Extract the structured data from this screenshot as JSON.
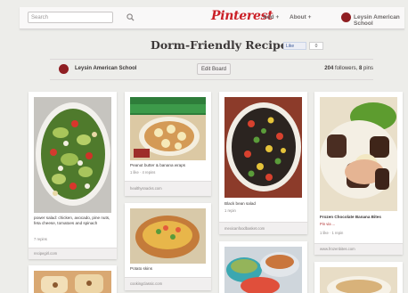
{
  "header": {
    "search_placeholder": "Search",
    "logo": "Pinterest",
    "add": "Add +",
    "about": "About +",
    "user": "Leysin American School"
  },
  "board": {
    "title": "Dorm-Friendly Recipes",
    "fb_like": "Like",
    "owner": "Leysin American School",
    "edit_label": "Edit Board",
    "followers": "204",
    "followers_label": "followers,",
    "pins": "8",
    "pins_label": "pins"
  },
  "pins": [
    {
      "desc": "power salad: chicken, avocado, pine nuts, feta cheese, tomatoes and spinach",
      "meta": "7 repins",
      "source": "recipegirl.com"
    },
    {
      "desc": "Peanut butter & banana wraps",
      "meta": "1 like · 4 repins",
      "source": "healthysnacks.com"
    },
    {
      "desc": "Black bean salad",
      "meta": "1 repin",
      "source": "mexicanfoodbasket.com"
    },
    {
      "desc": "Frozen Chocolate Banana Bites",
      "meta": "1 like · 1 repin",
      "source": "www.frozenbites.com",
      "comment": "Pin via ..."
    },
    {
      "desc": "Potato skins",
      "meta": "",
      "source": "cookingclassic.com"
    }
  ]
}
